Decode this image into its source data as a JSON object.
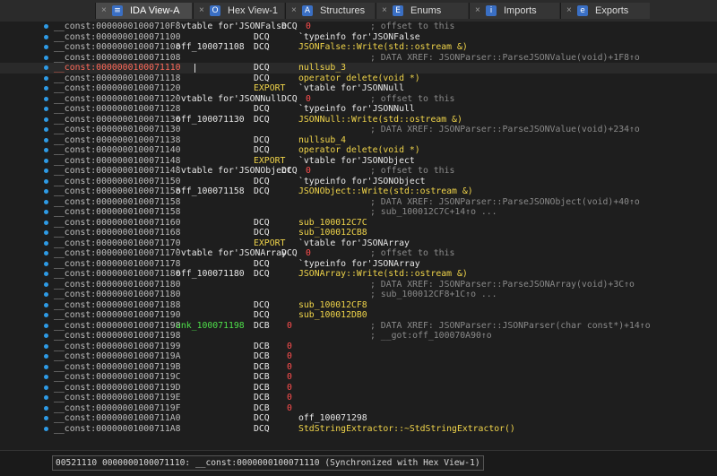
{
  "tabs": [
    {
      "label": "IDA View-A",
      "close": "×",
      "icon": "ida-view-icon",
      "icon_glyph": "≡",
      "active": true
    },
    {
      "label": "Hex View-1",
      "close": "×",
      "icon": "hex-view-icon",
      "icon_glyph": "O",
      "active": false
    },
    {
      "label": "Structures",
      "close": "×",
      "icon": "structures-icon",
      "icon_glyph": "A",
      "active": false
    },
    {
      "label": "Enums",
      "close": "×",
      "icon": "enums-icon",
      "icon_glyph": "E",
      "active": false
    },
    {
      "label": "Imports",
      "close": "×",
      "icon": "imports-icon",
      "icon_glyph": "i",
      "active": false
    },
    {
      "label": "Exports",
      "close": "×",
      "icon": "exports-icon",
      "icon_glyph": "e",
      "active": false
    }
  ],
  "colors": {
    "segment": "#bdbdbd",
    "segment_current": "#ff6a5a",
    "label_code": "#4ee04a",
    "operand": "#f0d44a",
    "zero": "#ff4d4d",
    "comment": "#8a8a8a",
    "tab_active": "#4a4a4a",
    "dot": "#2e9be6"
  },
  "listing": [
    {
      "seg": "__const:00000001000710F8",
      "vt": "`vtable for'JSONFalse",
      "vtop": "DCQ",
      "vtzero": "0",
      "vtcm": "; offset to this",
      "dot": true
    },
    {
      "seg": "__const:0000000100071100",
      "mn": "DCQ",
      "op": "`typeinfo for'JSONFalse",
      "opc": "white",
      "dot": true
    },
    {
      "seg": "__const:0000000100071108",
      "lbl": "off_100071108",
      "mn": "DCQ",
      "op": "JSONFalse::Write(std::ostream &)",
      "dot": true
    },
    {
      "seg": "__const:0000000100071108",
      "cm": "; DATA XREF: JSONParser::ParseJSONValue(void)+1F8↑o",
      "dot": true
    },
    {
      "seg": "__const:0000000100071110",
      "mn": "DCQ",
      "op": "nullsub_3",
      "current": true,
      "dot": true
    },
    {
      "seg": "__const:0000000100071118",
      "mn": "DCQ",
      "op": "operator delete(void *)",
      "dot": true
    },
    {
      "seg": "__const:0000000100071120",
      "mn": "EXPORT",
      "op": "`vtable for'JSONNull",
      "opc": "white",
      "mnc": "yellow",
      "dot": true
    },
    {
      "seg": "__const:0000000100071120",
      "vt": "`vtable for'JSONNull",
      "vtop": "DCQ",
      "vtzero": "0",
      "vtcm": "; offset to this",
      "dot": true
    },
    {
      "seg": "__const:0000000100071128",
      "mn": "DCQ",
      "op": "`typeinfo for'JSONNull",
      "opc": "white",
      "dot": true
    },
    {
      "seg": "__const:0000000100071130",
      "lbl": "off_100071130",
      "mn": "DCQ",
      "op": "JSONNull::Write(std::ostream &)",
      "dot": true
    },
    {
      "seg": "__const:0000000100071130",
      "cm": "; DATA XREF: JSONParser::ParseJSONValue(void)+234↑o",
      "dot": true
    },
    {
      "seg": "__const:0000000100071138",
      "mn": "DCQ",
      "op": "nullsub_4",
      "dot": true
    },
    {
      "seg": "__const:0000000100071140",
      "mn": "DCQ",
      "op": "operator delete(void *)",
      "dot": true
    },
    {
      "seg": "__const:0000000100071148",
      "mn": "EXPORT",
      "op": "`vtable for'JSONObject",
      "opc": "white",
      "mnc": "yellow",
      "dot": true
    },
    {
      "seg": "__const:0000000100071148",
      "vt": "`vtable for'JSONObject",
      "vtop": "DCQ",
      "vtzero": "0",
      "vtcm": "; offset to this",
      "dot": true
    },
    {
      "seg": "__const:0000000100071150",
      "mn": "DCQ",
      "op": "`typeinfo for'JSONObject",
      "opc": "white",
      "dot": true
    },
    {
      "seg": "__const:0000000100071158",
      "lbl": "off_100071158",
      "mn": "DCQ",
      "op": "JSONObject::Write(std::ostream &)",
      "dot": true
    },
    {
      "seg": "__const:0000000100071158",
      "cm": "; DATA XREF: JSONParser::ParseJSONObject(void)+40↑o",
      "dot": true
    },
    {
      "seg": "__const:0000000100071158",
      "cm": "; sub_100012C7C+14↑o ...",
      "dot": true
    },
    {
      "seg": "__const:0000000100071160",
      "mn": "DCQ",
      "op": "sub_100012C7C",
      "dot": true
    },
    {
      "seg": "__const:0000000100071168",
      "mn": "DCQ",
      "op": "sub_100012CB8",
      "dot": true
    },
    {
      "seg": "__const:0000000100071170",
      "mn": "EXPORT",
      "op": "`vtable for'JSONArray",
      "opc": "white",
      "mnc": "yellow",
      "dot": true
    },
    {
      "seg": "__const:0000000100071170",
      "vt": "`vtable for'JSONArray",
      "vtop": "DCQ",
      "vtzero": "0",
      "vtcm": "; offset to this",
      "dot": true
    },
    {
      "seg": "__const:0000000100071178",
      "mn": "DCQ",
      "op": "`typeinfo for'JSONArray",
      "opc": "white",
      "dot": true
    },
    {
      "seg": "__const:0000000100071180",
      "lbl": "off_100071180",
      "mn": "DCQ",
      "op": "JSONArray::Write(std::ostream &)",
      "dot": true
    },
    {
      "seg": "__const:0000000100071180",
      "cm": "; DATA XREF: JSONParser::ParseJSONArray(void)+3C↑o",
      "dot": true
    },
    {
      "seg": "__const:0000000100071180",
      "cm": "; sub_100012CF8+1C↑o ...",
      "dot": true
    },
    {
      "seg": "__const:0000000100071188",
      "mn": "DCQ",
      "op": "sub_100012CF8",
      "dot": true
    },
    {
      "seg": "__const:0000000100071190",
      "mn": "DCQ",
      "op": "sub_100012DB0",
      "dot": true
    },
    {
      "seg": "__const:0000000100071198",
      "lbl": "unk_100071198",
      "lblc": "green",
      "mn": "DCB",
      "op": "0",
      "opc": "red",
      "cm": "; DATA XREF: JSONParser::JSONParser(char const*)+14↑o",
      "dot": true
    },
    {
      "seg": "__const:0000000100071198",
      "cm": "; __got:off_100070A90↑o",
      "dot": true
    },
    {
      "seg": "__const:0000000100071199",
      "mn": "DCB",
      "op": "0",
      "opc": "red",
      "dot": true
    },
    {
      "seg": "__const:000000010007119A",
      "mn": "DCB",
      "op": "0",
      "opc": "red",
      "dot": true
    },
    {
      "seg": "__const:000000010007119B",
      "mn": "DCB",
      "op": "0",
      "opc": "red",
      "dot": true
    },
    {
      "seg": "__const:000000010007119C",
      "mn": "DCB",
      "op": "0",
      "opc": "red",
      "dot": true
    },
    {
      "seg": "__const:000000010007119D",
      "mn": "DCB",
      "op": "0",
      "opc": "red",
      "dot": true
    },
    {
      "seg": "__const:000000010007119E",
      "mn": "DCB",
      "op": "0",
      "opc": "red",
      "dot": true
    },
    {
      "seg": "__const:000000010007119F",
      "mn": "DCB",
      "op": "0",
      "opc": "red",
      "dot": true
    },
    {
      "seg": "__const:00000001000711A0",
      "mn": "DCQ",
      "op": "off_100071298",
      "opc": "white",
      "dot": true
    },
    {
      "seg": "__const:00000001000711A8",
      "mn": "DCQ",
      "op": "StdStringExtractor::~StdStringExtractor()",
      "dot": true
    }
  ],
  "status": {
    "text": "00521110 0000000100071110: __const:0000000100071110 (Synchronized with Hex View-1)"
  }
}
